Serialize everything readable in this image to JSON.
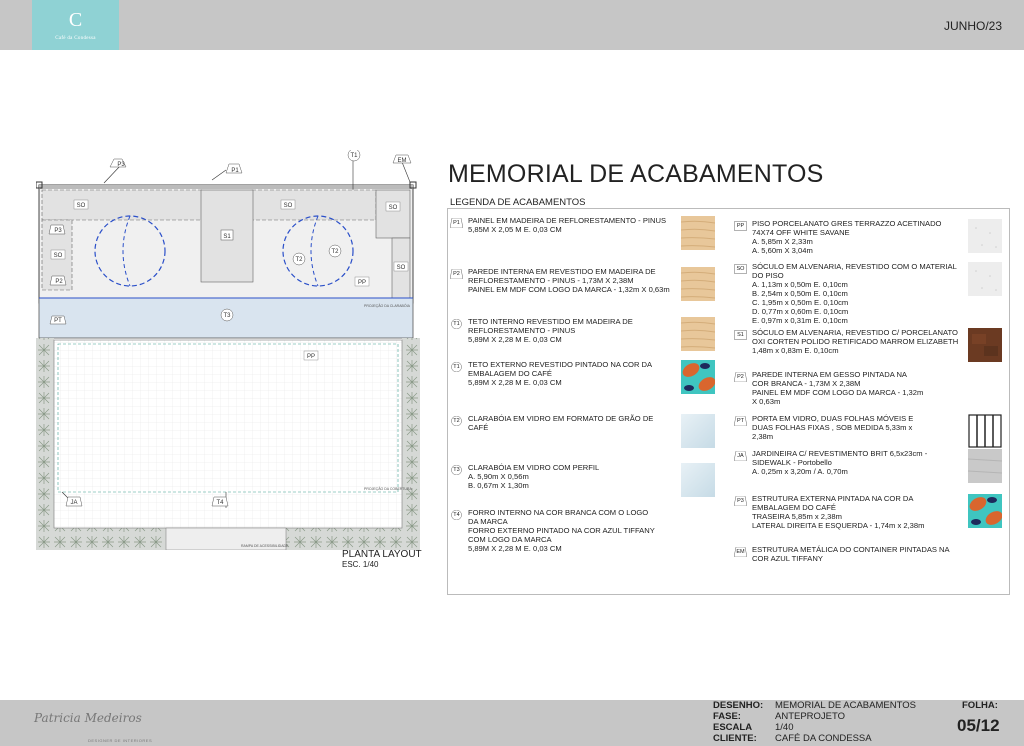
{
  "header": {
    "logo_letter": "C",
    "logo_sub": "Café da Condessa",
    "date": "JUNHO/23"
  },
  "plan": {
    "title": "PLANTA LAYOUT",
    "scale": "ESC. 1/40",
    "tags": {
      "p3_top": "P3",
      "p1_top": "P1",
      "t1_top": "T1",
      "em_top": "EM",
      "so1": "SO",
      "so2": "SO",
      "so3": "SO",
      "so4": "SO",
      "so5": "SO",
      "p3_left": "P3",
      "p2_left": "P2",
      "s1": "S1",
      "t2a": "T2",
      "t2b": "T2",
      "pp1": "PP",
      "t3": "T3",
      "pt": "PT",
      "pp2": "PP",
      "ja": "JA",
      "t4": "T4"
    },
    "notes": {
      "projecao_claraboia": "PROJEÇÃO DA CLARABÓIA",
      "projecao_cobertura": "PROJEÇÃO DA COBERTURA",
      "rampa": "RAMPA DE ACESSIBILIDADE"
    }
  },
  "title": "MEMORIAL DE ACABAMENTOS",
  "legend_title": "LEGENDA DE ACABAMENTOS",
  "legend_left": [
    {
      "code": "P1",
      "lines": [
        "PAINEL EM MADEIRA DE REFLORESTAMENTO - PINUS",
        "5,85M X 2,05 M E. 0,03 CM"
      ],
      "swatch": "wood"
    },
    {
      "code": "P2",
      "lines": [
        "PAREDE INTERNA EM REVESTIDO EM MADEIRA DE",
        "REFLORESTAMENTO - PINUS - 1,73M X 2,38M",
        "PAINEL EM MDF COM LOGO DA MARCA - 1,32m X 0,63m"
      ],
      "swatch": "wood"
    },
    {
      "code": "T1",
      "lines": [
        "TETO INTERNO REVESTIDO EM MADEIRA DE",
        "REFLORESTAMENTO - PINUS",
        "5,89M X 2,28 M E. 0,03 CM"
      ],
      "swatch": "wood"
    },
    {
      "code": "T1",
      "lines": [
        "TETO EXTERNO REVESTIDO PINTADO NA COR DA",
        "EMBALAGEM DO CAFÉ",
        "5,89M X 2,28 M E. 0,03 CM"
      ],
      "swatch": "pattern"
    },
    {
      "code": "T2",
      "lines": [
        "CLARABÓIA EM VIDRO EM FORMATO DE GRÃO DE",
        "CAFÉ"
      ],
      "swatch": "glass"
    },
    {
      "code": "T3",
      "lines": [
        "CLARABÓIA EM VIDRO COM PERFIL",
        "A. 5,90m X 0,56m",
        "B. 0,67m X 1,30m"
      ],
      "swatch": "glass"
    },
    {
      "code": "T4",
      "lines": [
        "FORRO INTERNO NA COR BRANCA COM O LOGO",
        "DA MARCA",
        "FORRO EXTERNO PINTADO NA COR AZUL TIFFANY",
        "COM LOGO DA MARCA",
        "5,89M X 2,28 M E. 0,03 CM"
      ],
      "swatch": ""
    }
  ],
  "legend_right": [
    {
      "code": "PP",
      "lines": [
        "PISO PORCELANATO GRES TERRAZZO ACETINADO",
        "74X74 OFF WHITE SAVANE",
        "A. 5,85m X 2,33m",
        "A. 5,60m X 3,04m"
      ],
      "swatch": "terrazzo"
    },
    {
      "code": "SO",
      "lines": [
        "SÓCULO EM ALVENARIA, REVESTIDO COM O MATERIAL",
        "DO PISO",
        "A. 1,13m x 0,50m E. 0,10cm",
        "B. 2,54m x 0,50m E. 0,10cm",
        "C. 1,95m x 0,50m E. 0,10cm",
        "D. 0,77m x 0,60m E. 0,10cm",
        "E. 0,97m x 0,31m E. 0,10cm"
      ],
      "swatch": "terrazzo"
    },
    {
      "code": "S1",
      "lines": [
        "SÓCULO EM ALVENARIA, REVESTIDO C/ PORCELANATO",
        "OXI CORTEN POLIDO RETIFICADO MARROM ELIZABETH",
        "1,48m x 0,83m E. 0,10cm"
      ],
      "swatch": "corten"
    },
    {
      "code": "P2",
      "lines": [
        "PAREDE INTERNA EM GESSO PINTADA NA",
        "COR BRANCA - 1,73M X 2,38M",
        "PAINEL EM MDF COM LOGO DA MARCA - 1,32m",
        "X 0,63m"
      ],
      "swatch": ""
    },
    {
      "code": "PT",
      "lines": [
        "PORTA EM VIDRO, DUAS FOLHAS MÓVEIS E",
        "DUAS FOLHAS FIXAS , SOB MEDIDA 5,33m x",
        "2,38m"
      ],
      "swatch": "door"
    },
    {
      "code": "JA",
      "lines": [
        "JARDINEIRA C/ REVESTIMENTO BRIT 6,5x23cm -",
        "SIDEWALK - Portobello",
        "A. 0,25m x 3,20m / A. 0,70m"
      ],
      "swatch": "concrete"
    },
    {
      "code": "P3",
      "lines": [
        "ESTRUTURA EXTERNA PINTADA NA COR DA",
        "EMBALAGEM DO CAFÉ",
        "TRASEIRA 5,85m x 2,38m",
        "LATERAL DIREITA E ESQUERDA - 1,74m x 2,38m"
      ],
      "swatch": "pattern"
    },
    {
      "code": "EM",
      "lines": [
        "ESTRUTURA METÁLICA DO CONTAINER PINTADAS NA",
        "COR AZUL TIFFANY"
      ],
      "swatch": ""
    }
  ],
  "footer": {
    "signature_name": "Patricia Medeiros",
    "signature_sub": "DESIGNER DE INTERIORES",
    "desenho_label": "DESENHO:",
    "desenho": "MEMORIAL DE ACABAMENTOS",
    "fase_label": "FASE:",
    "fase": "ANTEPROJETO",
    "escala_label": "ESCALA",
    "escala": "1/40",
    "cliente_label": "CLIENTE:",
    "cliente": "CAFÉ DA CONDESSA",
    "folha_label": "FOLHA:",
    "folha": "05/12"
  },
  "colors": {
    "bar": "#c6c6c6",
    "logo_bg": "#8fd2d4",
    "dash_blue": "#2a4fc9",
    "tiffany": "#3fc5c0"
  }
}
